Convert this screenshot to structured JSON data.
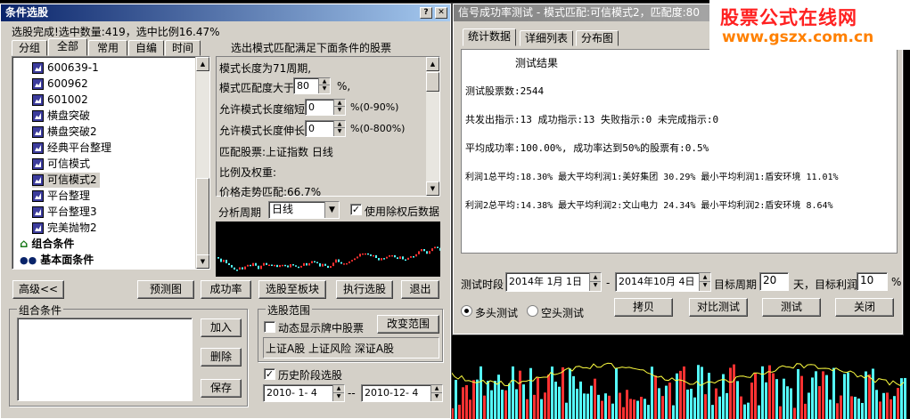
{
  "left_window": {
    "title": "条件选股",
    "status": "选股完成!选中数量:419，选中比例16.47%",
    "tabs": [
      "分组",
      "全部",
      "常用",
      "自编",
      "时间"
    ],
    "tree_items": [
      "600639-1",
      "600962",
      "601002",
      "横盘突破",
      "横盘突破2",
      "经典平台整理",
      "可信模式",
      "可信模式2",
      "平台整理",
      "平台整理3",
      "完美抛物2"
    ],
    "tree_groups": [
      "组合条件",
      "基本面条件"
    ],
    "condition_header": "选出模式匹配满足下面条件的股票",
    "cond_line1": "模式长度为71周期,",
    "cond_match_label": "模式匹配度大于",
    "cond_match_value": "80",
    "cond_match_unit": "%,",
    "cond_shrink_label": "允许模式长度缩短",
    "cond_shrink_value": "0",
    "cond_shrink_unit": "%(0-90%)",
    "cond_stretch_label": "允许模式长度伸长",
    "cond_stretch_value": "0",
    "cond_stretch_unit": "%(0-800%)",
    "cond_line5": "匹配股票:上证指数 日线",
    "cond_line6": "比例及权重:",
    "cond_line7": "价格走势匹配:66.7%",
    "period_label": "分析周期",
    "period_value": "日线",
    "use_adjusted": "使用除权后数据",
    "buttons": {
      "advanced": "高级<<",
      "predict": "预测图",
      "success_rate": "成功率",
      "to_block": "选股至板块",
      "execute": "执行选股",
      "exit": "退出"
    },
    "combo_group": "组合条件",
    "combo_buttons": {
      "add": "加入",
      "delete": "删除",
      "save": "保存"
    },
    "range_group": "选股范围",
    "dynamic_show": "动态显示牌中股票",
    "change_range": "改变范围",
    "range_text": "上证A股 上证风险 深证A股",
    "history_label": "历史阶段选股",
    "date_from": "2010- 1- 4",
    "date_sep": "--",
    "date_to": "2010-12- 4"
  },
  "right_window": {
    "title": "信号成功率测试 - 模式匹配:可信模式2，匹配度:80",
    "tabs": [
      "统计数据",
      "详细列表",
      "分布图"
    ],
    "results": [
      "测试结果",
      "测试股票数:2544",
      "共发出指示:13 成功指示:13 失败指示:0 未完成指示:0",
      "平均成功率:100.00%, 成功率达到50%的股票有:0.5%",
      "利润1总平均:18.30% 最大平均利润1:美好集团 30.29% 最小平均利润1:盾安环境 11.01%",
      "利润2总平均:14.38% 最大平均利润2:文山电力 24.34% 最小平均利润2:盾安环境 8.64%"
    ],
    "period_label": "测试时段",
    "start_date": "2014年 1月 1日",
    "dash": "-",
    "end_date": "2014年10月 4日",
    "target_period_label": "目标周期",
    "target_period_value": "20",
    "target_profit_label": "天，目标利润",
    "target_profit_value": "10",
    "percent": "%",
    "long_test": "多头测试",
    "short_test": "空头测试",
    "buttons": {
      "copy": "拷贝",
      "compare": "对比测试",
      "test": "测试",
      "close": "关闭"
    }
  },
  "watermark": {
    "line1": "股票公式在线网",
    "line2": "www.gszx.com.cn"
  },
  "colors": {
    "title_start": "#0a246a",
    "title_end": "#a6caf0",
    "window": "#d4d0c8",
    "up_candle": "#ff3232",
    "down_candle": "#54fcfc",
    "watermark_red": "#ff2020",
    "watermark_orange": "#ff8000"
  }
}
